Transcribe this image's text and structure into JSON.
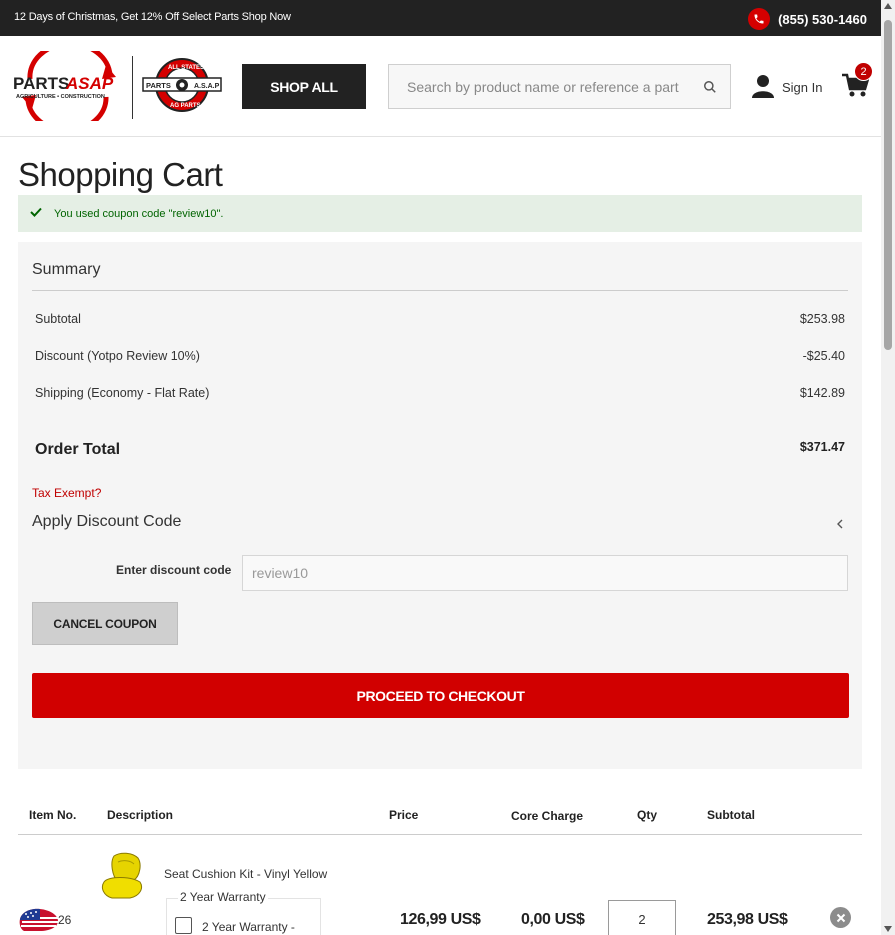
{
  "topbar": {
    "promo_text": "12 Days of Christmas, Get 12% Off Select Parts Shop Now",
    "phone": "(855) 530-1460",
    "phone_icon": "phone-icon"
  },
  "header": {
    "logo_main": {
      "brand_left": "PARTS",
      "brand_right": "ASAP",
      "tagline": "AGRICULTURE • CONSTRUCTION"
    },
    "logo_seal": {
      "top_text": "ALL STATES",
      "left_text": "PARTS",
      "right_text": "A.S.A.P",
      "bottom_text": "AG PARTS"
    },
    "shop_all_label": "SHOP ALL",
    "search_placeholder": "Search by product name or reference a part",
    "signin_label": "Sign In",
    "cart_count": "2"
  },
  "page_title": "Shopping Cart",
  "alert": {
    "message": "You used coupon code \"review10\".",
    "color": "#006400"
  },
  "summary": {
    "title": "Summary",
    "rows": [
      {
        "label": "Subtotal",
        "value": "$253.98"
      },
      {
        "label": "Discount (Yotpo Review 10%)",
        "value": "-$25.40"
      },
      {
        "label": "Shipping (Economy - Flat Rate)",
        "value": "$142.89"
      }
    ],
    "order_total_label": "Order Total",
    "order_total_value": "$371.47",
    "tax_exempt_link": "Tax Exempt?",
    "discount_title": "Apply Discount Code",
    "discount_input_label": "Enter discount code",
    "discount_input_value": "review10",
    "cancel_coupon_label": "CANCEL COUPON",
    "checkout_label": "PROCEED TO CHECKOUT",
    "accent_color": "#d10000"
  },
  "table": {
    "headers": [
      "Item No.",
      "Description",
      "Price",
      "Core Charge",
      "Qty",
      "Subtotal"
    ],
    "items": [
      {
        "name": "Seat Cushion Kit - Vinyl Yellow",
        "warranty_title": "2 Year Warranty",
        "warranty_option": "2 Year Warranty -",
        "price": "126,99 US$",
        "core_charge": "0,00 US$",
        "qty": "2",
        "subtotal": "253,98 US$"
      }
    ]
  },
  "flag_widget": {
    "count": "26",
    "icon": "us-flag-icon"
  }
}
